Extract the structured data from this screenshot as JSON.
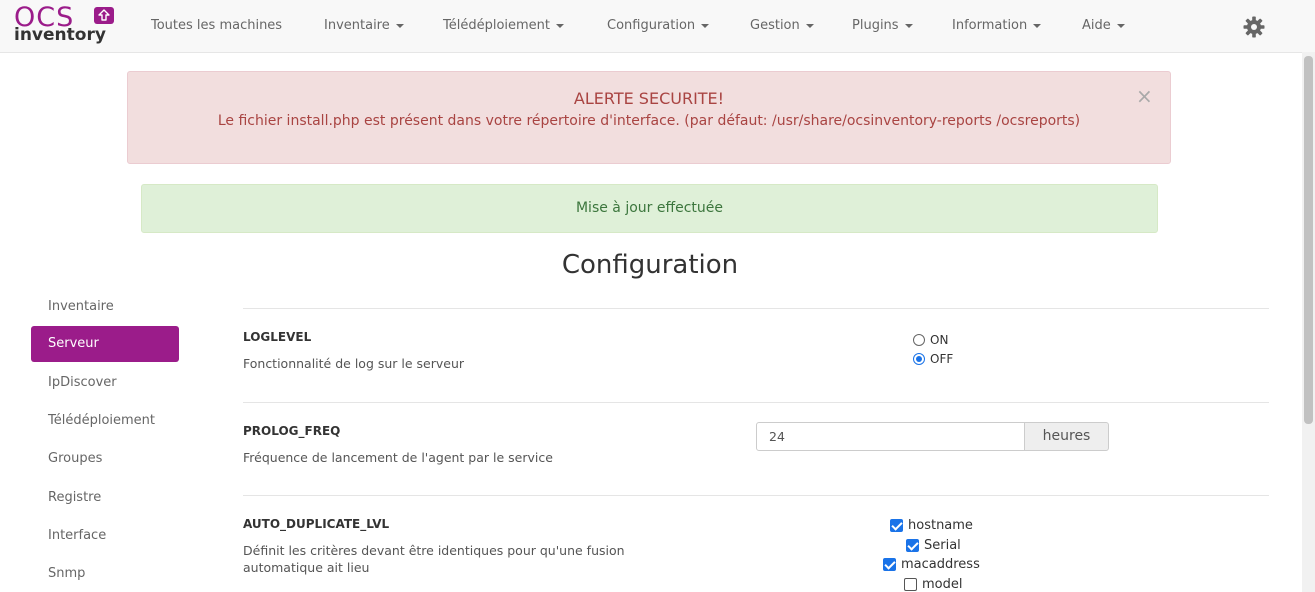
{
  "logo": {
    "line1": "OCS",
    "line2": "inventory"
  },
  "nav": [
    {
      "label": "Toutes les machines",
      "dropdown": false
    },
    {
      "label": "Inventaire",
      "dropdown": true
    },
    {
      "label": "Télédéploiement",
      "dropdown": true
    },
    {
      "label": "Configuration",
      "dropdown": true
    },
    {
      "label": "Gestion",
      "dropdown": true
    },
    {
      "label": "Plugins",
      "dropdown": true
    },
    {
      "label": "Information",
      "dropdown": true
    },
    {
      "label": "Aide",
      "dropdown": true
    }
  ],
  "alert": {
    "title": "ALERTE SECURITE!",
    "message": "Le fichier install.php est présent dans votre répertoire d'interface. (par défaut: /usr/share/ocsinventory-reports /ocsreports)",
    "close": "×"
  },
  "success": "Mise à jour effectuée",
  "page_title": "Configuration",
  "sidebar": {
    "items": [
      "Inventaire",
      "Serveur",
      "IpDiscover",
      "Télédéploiement",
      "Groupes",
      "Registre",
      "Interface",
      "Snmp"
    ],
    "active": "Serveur"
  },
  "options": {
    "loglevel": {
      "name": "LOGLEVEL",
      "desc": "Fonctionnalité de log sur le serveur",
      "on_label": "ON",
      "off_label": "OFF",
      "value": "OFF"
    },
    "prolog_freq": {
      "name": "PROLOG_FREQ",
      "desc": "Fréquence de lancement de l'agent par le service",
      "value": "24",
      "unit": "heures"
    },
    "auto_duplicate": {
      "name": "AUTO_DUPLICATE_LVL",
      "desc": "Définit les critères devant être identiques pour qu'une fusion automatique ait lieu",
      "checks": [
        {
          "label": "hostname",
          "checked": true
        },
        {
          "label": "Serial",
          "checked": true
        },
        {
          "label": "macaddress",
          "checked": true
        },
        {
          "label": "model",
          "checked": false
        }
      ]
    }
  },
  "colors": {
    "brand": "#9b1c8a",
    "danger_bg": "#f2dede",
    "success_bg": "#dff0d8",
    "accent": "#1a73e8"
  }
}
